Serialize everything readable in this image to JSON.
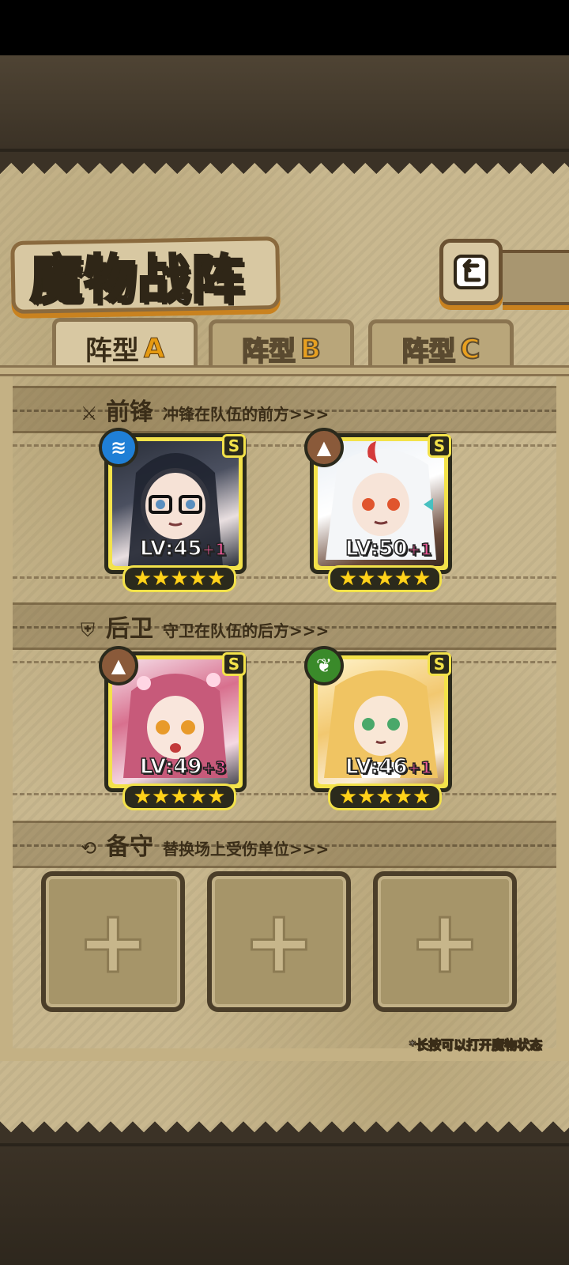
{
  "title": "魔物战阵",
  "tabs": [
    {
      "prefix": "阵型",
      "letter": "A"
    },
    {
      "prefix": "阵型",
      "letter": "B"
    },
    {
      "prefix": "阵型",
      "letter": "C"
    }
  ],
  "sections": {
    "front": {
      "title": "前锋",
      "desc": "冲锋在队伍的前方>>>",
      "icon": "sword-icon"
    },
    "rear": {
      "title": "后卫",
      "desc": "守卫在队伍的后方>>>",
      "icon": "shield-icon"
    },
    "reserve": {
      "title": "备守",
      "desc": "替换场上受伤单位>>>",
      "icon": "swap-icon"
    }
  },
  "front_units": [
    {
      "level": "LV:45",
      "bonus": "+1",
      "rank": "S",
      "stars": "★★★★★",
      "element": "water-icon",
      "element_color": "#1f7fd6",
      "element_glyph": "≋"
    },
    {
      "level": "LV:50",
      "bonus": "+1",
      "rank": "S",
      "stars": "★★★★★",
      "element": "earth-icon",
      "element_color": "#8a5a3a",
      "element_glyph": "▲"
    }
  ],
  "rear_units": [
    {
      "level": "LV:49",
      "bonus": "+3",
      "rank": "S",
      "stars": "★★★★★",
      "element": "earth-icon",
      "element_color": "#8a5a3a",
      "element_glyph": "▲"
    },
    {
      "level": "LV:46",
      "bonus": "+1",
      "rank": "S",
      "stars": "★★★★★",
      "element": "leaf-icon",
      "element_color": "#3a8a2a",
      "element_glyph": "❦"
    }
  ],
  "reserve_slots": [
    "+",
    "+",
    "+"
  ],
  "hint": "*长按可以打开魔物状态"
}
